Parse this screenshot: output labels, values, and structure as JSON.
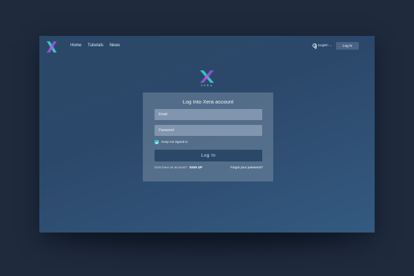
{
  "nav": {
    "items": [
      {
        "label": "Home"
      },
      {
        "label": "Tutorials"
      },
      {
        "label": "News"
      }
    ]
  },
  "header": {
    "language": "English",
    "language_icon": "globe-icon",
    "login_label": "Log In"
  },
  "brand": {
    "wordmark": "XERA",
    "colors": {
      "cyan": "#35c3c6",
      "purple": "#8a5cd6",
      "pink": "#d25ad2"
    }
  },
  "login_card": {
    "title": "Log Into Xera account",
    "email_placeholder": "Email",
    "password_placeholder": "Password",
    "keep_signed_in": "Keep me signed in",
    "keep_signed_in_checked": true,
    "submit_label": "Log In",
    "no_account_text": "Dont have an account?",
    "signup_label": "SIGN UP",
    "forgot_label": "Forgot your password?"
  }
}
